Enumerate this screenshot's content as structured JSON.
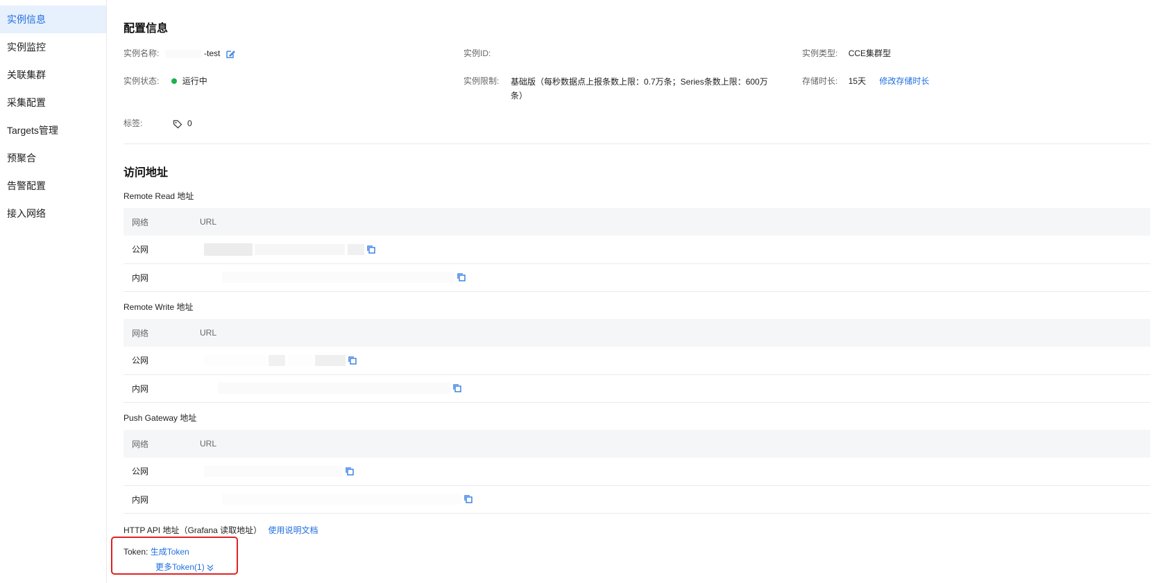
{
  "sidebar": {
    "items": [
      {
        "label": "实例信息",
        "active": true
      },
      {
        "label": "实例监控"
      },
      {
        "label": "关联集群"
      },
      {
        "label": "采集配置"
      },
      {
        "label": "Targets管理"
      },
      {
        "label": "预聚合"
      },
      {
        "label": "告警配置"
      },
      {
        "label": "接入网络"
      }
    ]
  },
  "config": {
    "title": "配置信息",
    "name_label": "实例名称:",
    "name_value": "-test",
    "id_label": "实例ID:",
    "type_label": "实例类型:",
    "type_value": "CCE集群型",
    "status_label": "实例状态:",
    "status_value": "运行中",
    "limit_label": "实例限制:",
    "limit_value": "基础版（每秒数据点上报条数上限：0.7万条；Series条数上限：600万条）",
    "storage_label": "存储时长:",
    "storage_value": "15天",
    "storage_link": "修改存储时长",
    "tags_label": "标签:",
    "tags_value": "0"
  },
  "access": {
    "title": "访问地址",
    "remote_read": {
      "title": "Remote Read 地址",
      "col_network": "网络",
      "col_url": "URL",
      "rows": [
        {
          "network": "公网"
        },
        {
          "network": "内网"
        }
      ]
    },
    "remote_write": {
      "title": "Remote Write 地址",
      "col_network": "网络",
      "col_url": "URL",
      "rows": [
        {
          "network": "公网"
        },
        {
          "network": "内网"
        }
      ]
    },
    "push_gateway": {
      "title": "Push Gateway 地址",
      "col_network": "网络",
      "col_url": "URL",
      "rows": [
        {
          "network": "公网"
        },
        {
          "network": "内网"
        }
      ]
    },
    "http_api_title": "HTTP API 地址（Grafana 读取地址）",
    "http_api_doc_link": "使用说明文档",
    "token_label": "Token:",
    "token_generate": "生成Token",
    "token_more": "更多Token(1)"
  },
  "colors": {
    "accent": "#1f6fe0",
    "status_running": "#1ab34b",
    "highlight_box": "#e02020"
  }
}
